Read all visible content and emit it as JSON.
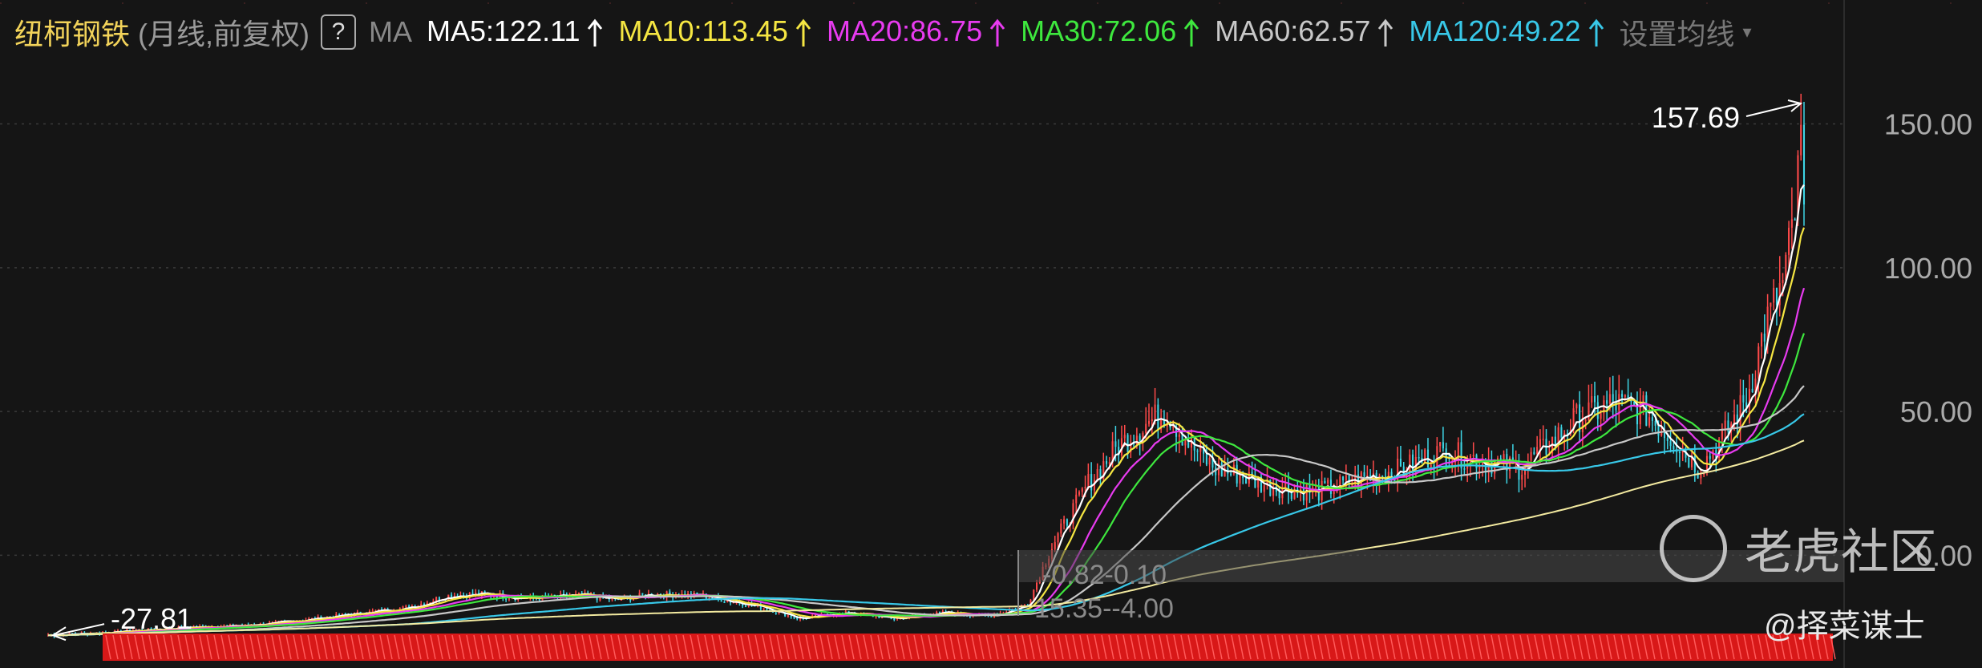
{
  "header": {
    "stock_name": "纽柯钢铁",
    "period_note": "(月线,前复权)",
    "help_label": "?",
    "ma_label": "MA",
    "settings_label": "设置均线",
    "caret": "▾"
  },
  "moving_averages": [
    {
      "label": "MA5:122.11",
      "color": "#ffffff"
    },
    {
      "label": "MA10:113.45",
      "color": "#f5e642"
    },
    {
      "label": "MA20:86.75",
      "color": "#e83bf0"
    },
    {
      "label": "MA30:72.06",
      "color": "#3ee83e"
    },
    {
      "label": "MA60:62.57",
      "color": "#c8c8c8"
    },
    {
      "label": "MA120:49.22",
      "color": "#38c8e8"
    }
  ],
  "annotations": {
    "high": "157.69",
    "low": "-27.81",
    "range_box_label": "-0.82-0.10",
    "range_box_label_2": "15.35--4.00"
  },
  "watermark": {
    "text": "老虎社区",
    "credit": "@择菜谋士"
  },
  "colors": {
    "up": "#ff4a4a",
    "down": "#3ed6e6",
    "background": "#151515",
    "grid": "#3a3a3a",
    "axis_text": "#aaaaaa"
  },
  "chart_data": {
    "type": "candlestick",
    "title": "纽柯钢铁 (月线,前复权)",
    "ylim": [
      -30,
      168
    ],
    "y_ticks": [
      0,
      50,
      100,
      150
    ],
    "y_tick_labels": [
      "0.00",
      "50.00",
      "100.00",
      "150.00"
    ],
    "grid": "horizontal dashed",
    "bars": 580,
    "price_path": [
      [
        0,
        -27.81
      ],
      [
        40,
        -27
      ],
      [
        80,
        -26
      ],
      [
        120,
        -25
      ],
      [
        160,
        -24.5
      ],
      [
        200,
        -23
      ],
      [
        260,
        -20
      ],
      [
        300,
        -18
      ],
      [
        330,
        -14
      ],
      [
        360,
        -13.5
      ],
      [
        400,
        -15
      ],
      [
        440,
        -14
      ],
      [
        470,
        -15.5
      ],
      [
        500,
        -13.5
      ],
      [
        540,
        -14
      ],
      [
        590,
        -18
      ],
      [
        620,
        -22
      ],
      [
        660,
        -20
      ],
      [
        700,
        -22
      ],
      [
        740,
        -20
      ],
      [
        780,
        -21
      ],
      [
        810,
        -17
      ],
      [
        830,
        3
      ],
      [
        860,
        25
      ],
      [
        885,
        38
      ],
      [
        905,
        45
      ],
      [
        925,
        50
      ],
      [
        945,
        38
      ],
      [
        965,
        30
      ],
      [
        985,
        28
      ],
      [
        1010,
        24
      ],
      [
        1050,
        22
      ],
      [
        1090,
        27
      ],
      [
        1120,
        30
      ],
      [
        1150,
        36
      ],
      [
        1190,
        33
      ],
      [
        1215,
        30
      ],
      [
        1240,
        38
      ],
      [
        1265,
        48
      ],
      [
        1295,
        53
      ],
      [
        1320,
        50
      ],
      [
        1345,
        40
      ],
      [
        1365,
        30
      ],
      [
        1385,
        41
      ],
      [
        1405,
        55
      ],
      [
        1420,
        80
      ],
      [
        1435,
        95
      ],
      [
        1445,
        120
      ],
      [
        1452,
        157.69
      ]
    ],
    "series": [
      {
        "name": "MA5",
        "final_value": 122.11
      },
      {
        "name": "MA10",
        "final_value": 113.45
      },
      {
        "name": "MA20",
        "final_value": 86.75
      },
      {
        "name": "MA30",
        "final_value": 72.06
      },
      {
        "name": "MA60",
        "final_value": 62.57
      },
      {
        "name": "MA120",
        "final_value": 49.22
      }
    ]
  }
}
